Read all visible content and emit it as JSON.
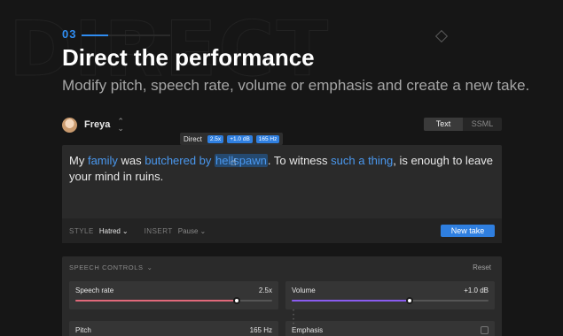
{
  "section": {
    "step": "03",
    "title": "Direct the performance",
    "subtitle": "Modify pitch, speech rate, volume or emphasis and create a new take."
  },
  "voice": {
    "name": "Freya",
    "avatar_icon": "avatar"
  },
  "mode_toggle": {
    "options": [
      "Text",
      "SSML"
    ],
    "active": "Text"
  },
  "direct_tooltip": {
    "label": "Direct",
    "badges": [
      "2.5x",
      "+1.0 dB",
      "165 Hz"
    ]
  },
  "editor": {
    "segments": [
      {
        "text": "My ",
        "style": "plain"
      },
      {
        "text": "family",
        "style": "directed"
      },
      {
        "text": " was ",
        "style": "plain"
      },
      {
        "text": "butchered by ",
        "style": "directed"
      },
      {
        "text": "hellspawn",
        "style": "selected"
      },
      {
        "text": ". To witness ",
        "style": "plain"
      },
      {
        "text": "such a thing",
        "style": "directed"
      },
      {
        "text": ", is enough to leave your mind in ruins.",
        "style": "plain"
      }
    ],
    "toolbar": {
      "style_label": "STYLE",
      "style_value": "Hatred",
      "insert_label": "INSERT",
      "insert_value": "Pause",
      "new_take": "New take"
    }
  },
  "speech_controls": {
    "heading": "SPEECH CONTROLS",
    "reset": "Reset",
    "controls": [
      {
        "name": "Speech rate",
        "value": "2.5x",
        "level": 0.82,
        "color": "#e0697a"
      },
      {
        "name": "Volume",
        "value": "+1.0 dB",
        "level": 0.6,
        "color": "#8a5cf0"
      },
      {
        "name": "Pitch",
        "value": "165 Hz"
      },
      {
        "name": "Emphasis",
        "value": ""
      }
    ]
  },
  "colors": {
    "accent": "#2f7fe0",
    "highlight_text": "#4a98ef"
  }
}
